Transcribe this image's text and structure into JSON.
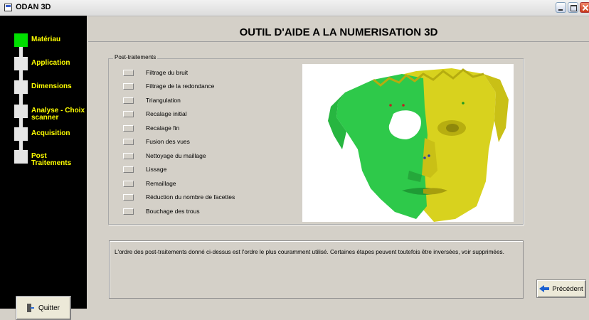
{
  "window": {
    "title": "ODAN 3D"
  },
  "header": {
    "title": "OUTIL D'AIDE A LA NUMERISATION 3D"
  },
  "sidebar": {
    "steps": [
      {
        "label": "Matériau",
        "active": true
      },
      {
        "label": "Application",
        "active": false
      },
      {
        "label": "Dimensions",
        "active": false
      },
      {
        "label": "Analyse - Choix scanner",
        "active": false
      },
      {
        "label": "Acquisition",
        "active": false
      },
      {
        "label": "Post Traitements",
        "active": false
      }
    ],
    "quit_label": "Quitter"
  },
  "group": {
    "legend": "Post-traitements",
    "items": [
      {
        "label": "Filtrage du bruit",
        "checked": false
      },
      {
        "label": "Filtrage de la redondance",
        "checked": false
      },
      {
        "label": "Triangulation",
        "checked": false
      },
      {
        "label": "Recalage initial",
        "checked": false
      },
      {
        "label": "Recalage fin",
        "checked": false
      },
      {
        "label": "Fusion des vues",
        "checked": false
      },
      {
        "label": "Nettoyage du maillage",
        "checked": false
      },
      {
        "label": "Lissage",
        "checked": false
      },
      {
        "label": "Remaillage",
        "checked": false
      },
      {
        "label": "Réduction du nombre de facettes",
        "checked": false
      },
      {
        "label": "Bouchage des trous",
        "checked": false
      }
    ]
  },
  "description": "L'ordre des post-traitements donné ci-dessus est l'ordre le plus couramment utilisé. Certaines étapes peuvent toutefois être inversées, voir supprimées.",
  "prev_label": "Précédent",
  "colors": {
    "active_step": "#00e000",
    "step_text": "#ffff00",
    "mesh_green": "#2ec94a",
    "mesh_yellow": "#d8d21e"
  }
}
